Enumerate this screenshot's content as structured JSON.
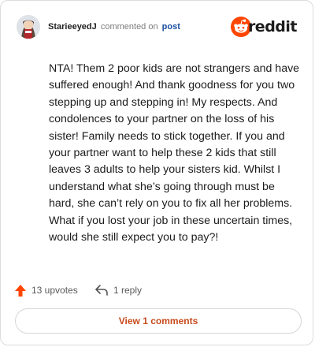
{
  "comment": {
    "username": "StarieeyedJ",
    "verb": "commented on",
    "target": "post",
    "body": "NTA! Them 2 poor kids are not strangers and have suffered enough! And thank goodness for you two stepping up and stepping in! My respects. And condolences to your partner on the loss of his sister! Family needs to stick together. If you and your partner want to help these 2 kids that still leaves 3 adults to help your sisters kid. Whilst I understand what she’s going through must be hard, she can’t rely on you to fix all her problems. What if you lost your job in these uncertain times, would she still expect you to pay?!",
    "upvotes_label": "13 upvotes",
    "replies_label": "1 reply"
  },
  "brand": {
    "name": "reddit",
    "accent": "#ff4500",
    "icon": "reddit-logo-icon"
  },
  "footer": {
    "view_label": "View 1 comments",
    "view_color": "#c74a1b"
  },
  "icons": {
    "upvote": "upvote-arrow-icon",
    "reply": "reply-arrow-icon",
    "avatar": "avatar"
  }
}
